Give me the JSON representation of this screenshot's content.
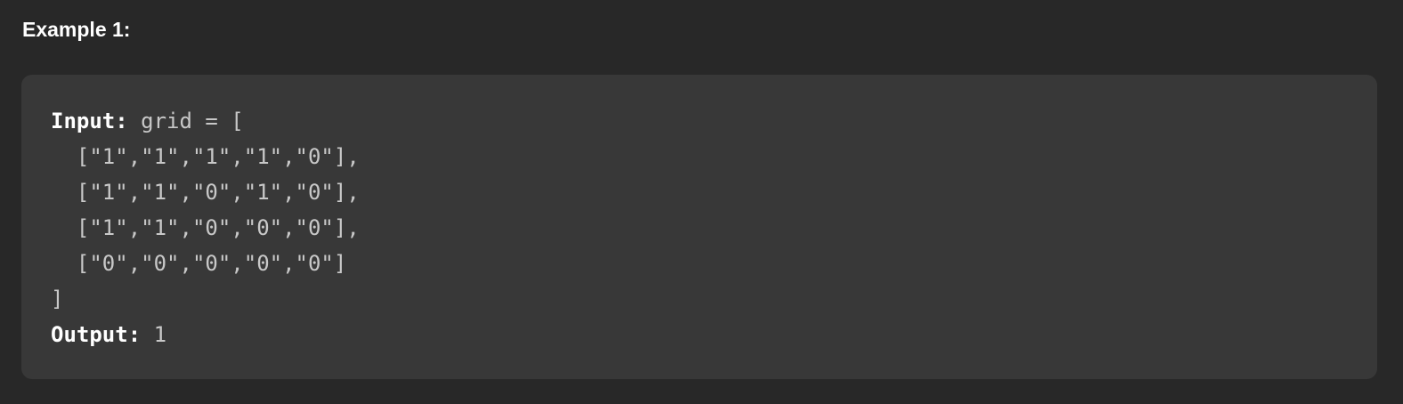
{
  "example": {
    "heading": "Example 1:",
    "input_label": "Input:",
    "input_value_open": " grid = [",
    "grid_rows": [
      "  [\"1\",\"1\",\"1\",\"1\",\"0\"],",
      "  [\"1\",\"1\",\"0\",\"1\",\"0\"],",
      "  [\"1\",\"1\",\"0\",\"0\",\"0\"],",
      "  [\"0\",\"0\",\"0\",\"0\",\"0\"]"
    ],
    "input_value_close": "]",
    "output_label": "Output:",
    "output_value": " 1"
  }
}
